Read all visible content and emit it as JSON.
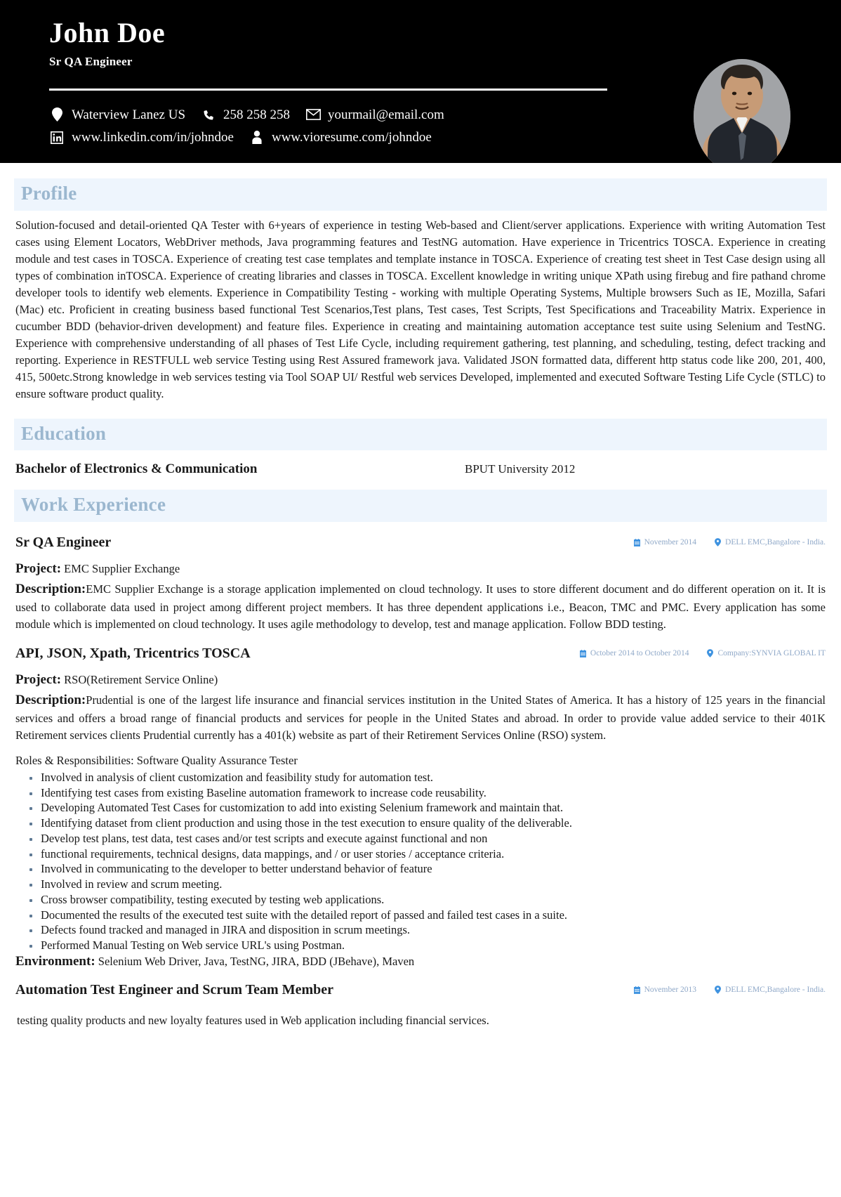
{
  "header": {
    "name": "John Doe",
    "job_title": "Sr QA Engineer",
    "contacts": [
      {
        "icon": "location-pin-icon",
        "text": "Waterview Lanez US"
      },
      {
        "icon": "phone-icon",
        "text": "258 258 258"
      },
      {
        "icon": "envelope-icon",
        "text": "yourmail@email.com"
      },
      {
        "icon": "linkedin-icon",
        "text": "www.linkedin.com/in/johndoe"
      },
      {
        "icon": "person-icon",
        "text": "www.vioresume.com/johndoe"
      }
    ],
    "avatar_alt": "profile-photo"
  },
  "sections": {
    "profile": {
      "title": "Profile",
      "text": "Solution-focused and detail-oriented QA Tester with 6+years of experience in testing Web-based and Client/server applications. Experience with writing Automation Test cases using Element Locators, WebDriver methods, Java programming features and TestNG automation. Have experience in Tricentrics TOSCA. Experience in creating module and test cases in TOSCA. Experience of creating test case templates and template instance in TOSCA. Experience of creating test sheet in Test Case design using all types of combination inTOSCA. Experience of creating libraries and classes in TOSCA. Excellent knowledge in writing unique XPath using firebug and fire pathand chrome developer tools to identify web elements. Experience in Compatibility Testing - working with multiple Operating Systems, Multiple browsers Such as IE, Mozilla, Safari (Mac) etc. Proficient in creating business based functional Test Scenarios,Test plans, Test cases, Test Scripts, Test Specifications and Traceability Matrix. Experience in cucumber BDD (behavior-driven development) and feature files. Experience in creating and maintaining automation acceptance test suite using Selenium and TestNG. Experience with comprehensive understanding of all phases of Test Life Cycle, including requirement gathering, test planning, and scheduling, testing, defect tracking and reporting. Experience in RESTFULL web service Testing using Rest Assured framework java. Validated JSON formatted data, different http status code like 200, 201, 400, 415, 500etc.Strong knowledge in web services testing via Tool SOAP UI/ Restful web services Developed, implemented and executed Software Testing Life Cycle (STLC) to ensure software product quality."
    },
    "education": {
      "title": "Education",
      "entries": [
        {
          "degree": "Bachelor of Electronics & Communication",
          "school": "BPUT University 2012"
        }
      ]
    },
    "work_experience": {
      "title": "Work Experience",
      "jobs": [
        {
          "title": "Sr QA Engineer",
          "date": "November 2014",
          "location": "DELL EMC,Bangalore - India.",
          "project_label": "Project:",
          "project": "EMC Supplier Exchange",
          "description_label": "Description:",
          "description": "EMC Supplier Exchange is a storage application implemented on cloud technology. It uses to store different document and do different operation on it. It is used to collaborate data used in project among different project members. It has three dependent applications i.e., Beacon, TMC and PMC. Every application has some module which is implemented on cloud technology. It uses agile methodology to develop, test and manage application. Follow BDD testing."
        },
        {
          "title": "API, JSON, Xpath, Tricentrics TOSCA",
          "date": "October 2014 to October 2014",
          "location": "Company:SYNVIA GLOBAL IT",
          "project_label": "Project:",
          "project": "RSO(Retirement Service Online)",
          "description_label": "Description:",
          "description": "Prudential is one of the largest life insurance and financial services institution in the United States of America. It has a history of 125 years in the financial services and offers a broad range of financial products and services for people in the United States and abroad. In order to provide value added service to their 401K Retirement services clients Prudential currently has a 401(k) website as part of their Retirement Services Online (RSO) system.",
          "roles_heading": "Roles & Responsibilities: Software Quality Assurance Tester",
          "bullets": [
            "Involved in analysis of client customization and feasibility study for automation test.",
            "Identifying test cases from existing Baseline automation framework to increase code reusability.",
            "Developing Automated Test Cases for customization to add into existing Selenium framework and maintain that.",
            "Identifying dataset from client production and using those in the test execution to ensure quality of the deliverable.",
            "Develop test plans, test data, test cases and/or test scripts and execute against functional and non",
            "functional requirements, technical designs, data mappings, and / or user stories / acceptance criteria.",
            "Involved in communicating to the developer to better understand behavior of feature",
            "Involved in review and scrum meeting.",
            "Cross browser compatibility, testing executed by testing web applications.",
            "Documented the results of the executed test suite with the detailed report of passed and failed test cases in a suite.",
            "Defects found tracked and managed in JIRA and disposition in scrum meetings.",
            "Performed Manual Testing on Web service URL's using Postman."
          ],
          "environment_label": "Environment:",
          "environment": "Selenium Web Driver, Java, TestNG, JIRA, BDD (JBehave), Maven"
        },
        {
          "title": "Automation Test Engineer and Scrum Team Member",
          "date": "November 2013",
          "location": "DELL EMC,Bangalore - India.",
          "tail_text": "testing quality products and new loyalty features used in Web application including financial services."
        }
      ]
    }
  },
  "colors": {
    "header_background": "#000000",
    "section_band": "#eef5fd",
    "section_title": "#9bb7cf",
    "meta_text": "#8fa8c8",
    "meta_icon": "#3f93e0"
  }
}
